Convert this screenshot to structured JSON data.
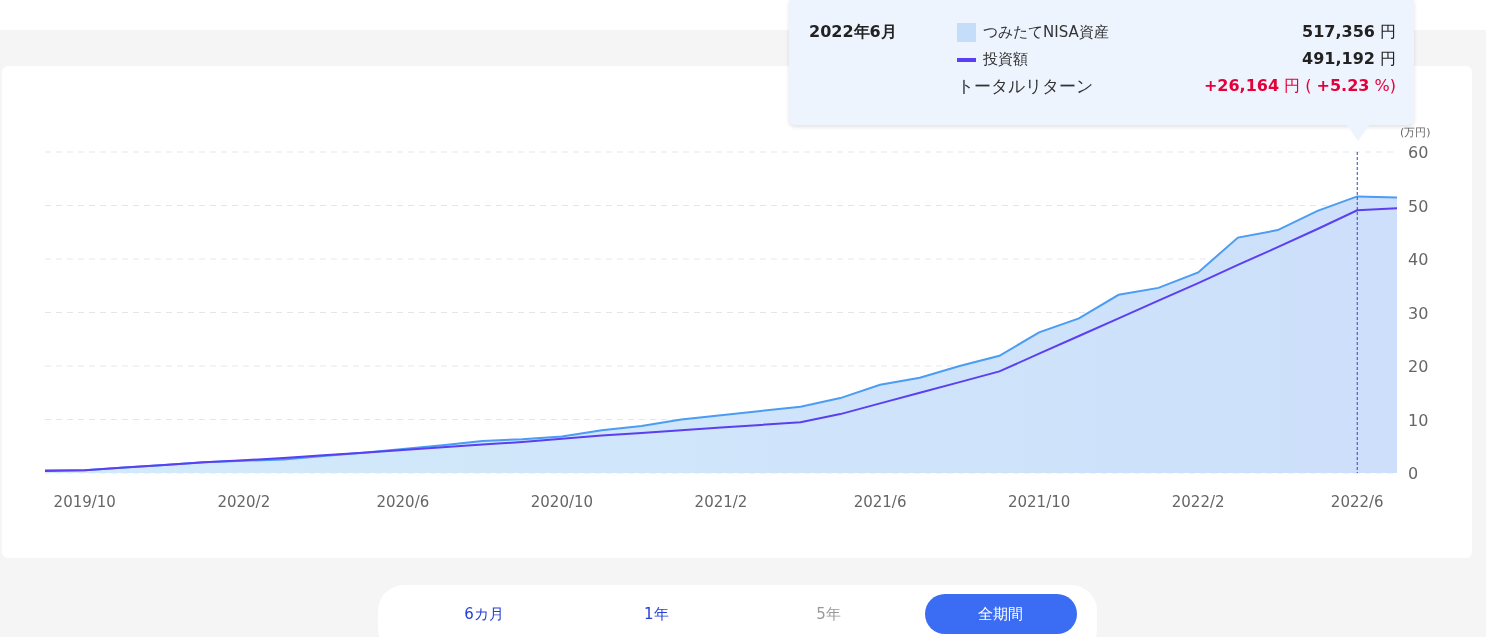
{
  "chart": {
    "chart_data": {
      "type": "area",
      "ylabel": "(万円)",
      "categories": [
        null,
        "2019/10",
        null,
        null,
        null,
        "2020/2",
        null,
        null,
        null,
        "2020/6",
        null,
        null,
        null,
        "2020/10",
        null,
        null,
        null,
        "2021/2",
        null,
        null,
        null,
        "2021/6",
        null,
        null,
        null,
        "2021/10",
        null,
        null,
        null,
        "2022/2",
        null,
        null,
        null,
        "2022/6",
        null
      ],
      "ylim": [
        0,
        60
      ],
      "yticks": [
        0,
        10,
        20,
        30,
        40,
        50,
        60
      ],
      "series": [
        {
          "name": "つみたてNISA資産",
          "color": "#4a9cf5",
          "type": "area",
          "values": [
            0.5,
            0.5,
            1.0,
            1.5,
            2.0,
            2.3,
            2.5,
            3.2,
            3.8,
            4.5,
            5.2,
            6.0,
            6.3,
            6.8,
            8.0,
            8.8,
            10.0,
            10.8,
            11.6,
            12.4,
            14.0,
            16.5,
            17.8,
            20.0,
            21.9,
            26.3,
            28.9,
            33.3,
            34.6,
            37.5,
            44.0,
            45.4,
            49.0,
            51.7,
            51.5
          ]
        },
        {
          "name": "投資額",
          "color": "#5b3ff0",
          "type": "line",
          "values": [
            0.4,
            0.5,
            1.0,
            1.5,
            2.0,
            2.4,
            2.8,
            3.3,
            3.8,
            4.3,
            4.8,
            5.3,
            5.8,
            6.4,
            7.0,
            7.5,
            8.0,
            8.5,
            9.0,
            9.5,
            11.0,
            13.0,
            15.0,
            17.0,
            19.0,
            22.3,
            25.6,
            28.9,
            32.2,
            35.5,
            38.9,
            42.2,
            45.6,
            49.1,
            49.5
          ]
        }
      ],
      "grid": true,
      "annotations": [
        {
          "x": "2022/6"
        }
      ]
    }
  },
  "tooltip": {
    "date": "2022年6月",
    "rows": [
      {
        "kind": "area",
        "color": "#c4def9",
        "value": "**517,356** 円"
      },
      {
        "kind": "line",
        "color": "#5b3ff0",
        "value": "**491,192** 円"
      },
      {
        "kind": "return",
        "label": "トータルリターン",
        "value": "**+26,164** 円 ( **+5.23** %)"
      }
    ]
  },
  "ranges": [
    {
      "label": "6カ月",
      "selected": false,
      "disabled": false
    },
    {
      "label": "1年",
      "selected": false,
      "disabled": false
    },
    {
      "label": "5年",
      "selected": false,
      "disabled": true
    },
    {
      "label": "全期間",
      "selected": true,
      "disabled": false
    }
  ]
}
